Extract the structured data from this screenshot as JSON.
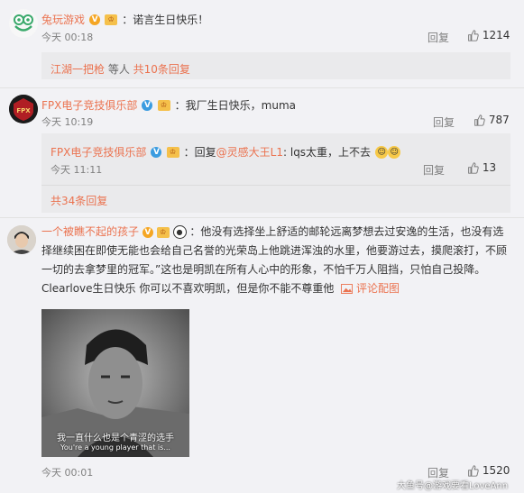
{
  "comments": [
    {
      "user": "兔玩游戏",
      "text": "：诺言生日快乐！",
      "time": "今天 00:18",
      "reply_label": "回复",
      "likes": "1214",
      "thread_user": "江湖一把枪",
      "thread_mid": " 等人 ",
      "thread_count": "共10条回复"
    },
    {
      "user": "FPX电子竞技俱乐部",
      "text": "：我厂生日快乐，muma",
      "time": "今天 10:19",
      "reply_label": "回复",
      "likes": "787",
      "sub": {
        "user": "FPX电子竞技俱乐部",
        "text_prefix": "：回复",
        "mention": "@灵感大王L1",
        "text_suffix": ": lqs太重，上不去",
        "time": "今天 11:11",
        "reply_label": "回复",
        "likes": "13"
      },
      "more": "共34条回复"
    },
    {
      "user": "一个被瞧不起的孩子",
      "text_lines": [
        "：他没有选择坐上舒适的邮轮远离梦想去过安逸的生活，也没有选",
        "择继续困在即使无能也会给自己名誉的光荣岛上他跳进浑浊的水里，他要游过去，摸爬滚打，不顾",
        "一切的去拿梦里的冠军。”这也是明凯在所有人心中的形象，不怕千万人阻挡，只怕自己投降。",
        "Clearlove生日快乐 你可以不喜欢明凯，但是你不能不尊重他"
      ],
      "view_pic": "评论配图",
      "photo_caption_cn": "我一直什么也是个青涩的选手",
      "photo_caption_en": "You're a young player that is...",
      "time": "今天 00:01",
      "reply_label": "回复",
      "likes": "1520"
    }
  ],
  "watermark": "大鱼号@游戏要看LoveAnn"
}
